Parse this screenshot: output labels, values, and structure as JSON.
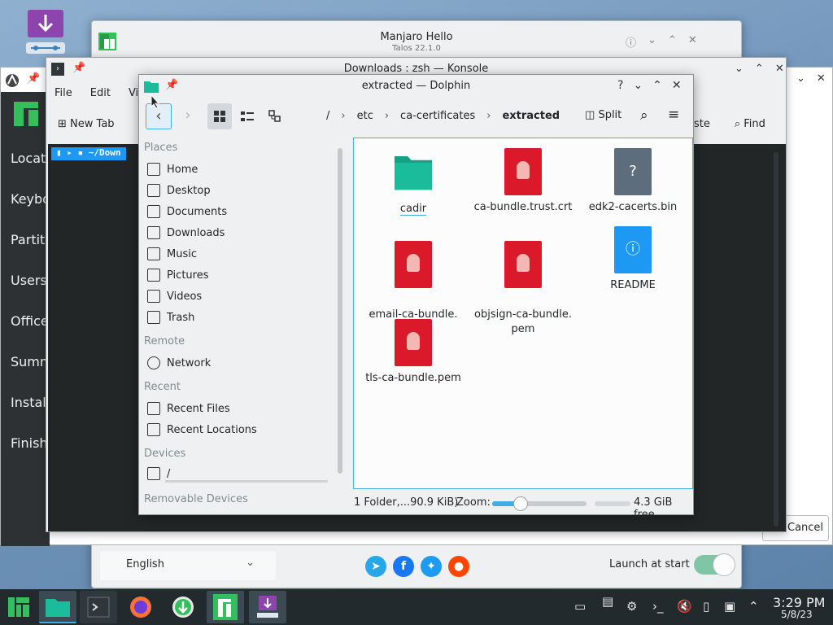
{
  "hello": {
    "title": "Manjaro Hello",
    "subtitle": "Talos 22.1.0",
    "language": "English",
    "launch_label": "Launch at start",
    "launch_enabled": true
  },
  "installer": {
    "sidebar": [
      "Locati",
      "Keybo",
      "Partiti",
      "Users",
      "Office",
      "Summ",
      "Instal",
      "Finish"
    ],
    "cancel_label": "Cancel"
  },
  "konsole": {
    "title": "Downloads : zsh — Konsole",
    "menu": [
      "File",
      "Edit",
      "Vie"
    ],
    "new_tab": "New Tab",
    "paste": "aste",
    "find": "Find",
    "prompt": "~/Down"
  },
  "dolphin": {
    "title": "extracted — Dolphin",
    "crumbs": [
      "/",
      "etc",
      "ca-certificates",
      "extracted"
    ],
    "split": "Split",
    "places": {
      "header_places": "Places",
      "items": [
        "Home",
        "Desktop",
        "Documents",
        "Downloads",
        "Music",
        "Pictures",
        "Videos",
        "Trash"
      ],
      "header_remote": "Remote",
      "remote_items": [
        "Network"
      ],
      "header_recent": "Recent",
      "recent_items": [
        "Recent Files",
        "Recent Locations"
      ],
      "header_devices": "Devices",
      "device_items": [
        "/"
      ],
      "header_removable": "Removable Devices"
    },
    "files": [
      {
        "name": "cadir",
        "kind": "folder"
      },
      {
        "name": "ca-bundle.trust.crt",
        "kind": "cert"
      },
      {
        "name": "edk2-cacerts.bin",
        "kind": "unknown"
      },
      {
        "name": "email-ca-bundle.\npem",
        "kind": "cert"
      },
      {
        "name": "objsign-ca-bundle.\npem",
        "kind": "cert"
      },
      {
        "name": "README",
        "kind": "info"
      },
      {
        "name": "tls-ca-bundle.pem",
        "kind": "cert"
      }
    ],
    "status": "1 Folder,...90.9 KiB)",
    "zoom_label": "Zoom:",
    "free": "4.3 GiB free",
    "zoom_level": 0.3
  },
  "taskbar": {
    "time": "3:29 PM",
    "date": "5/8/23"
  },
  "colors": {
    "accent": "#3daee9",
    "manjaro_green": "#35bf5c",
    "folder_teal": "#1abc9c",
    "cert_red": "#da1a2b",
    "taskbar": "#222a2e"
  }
}
